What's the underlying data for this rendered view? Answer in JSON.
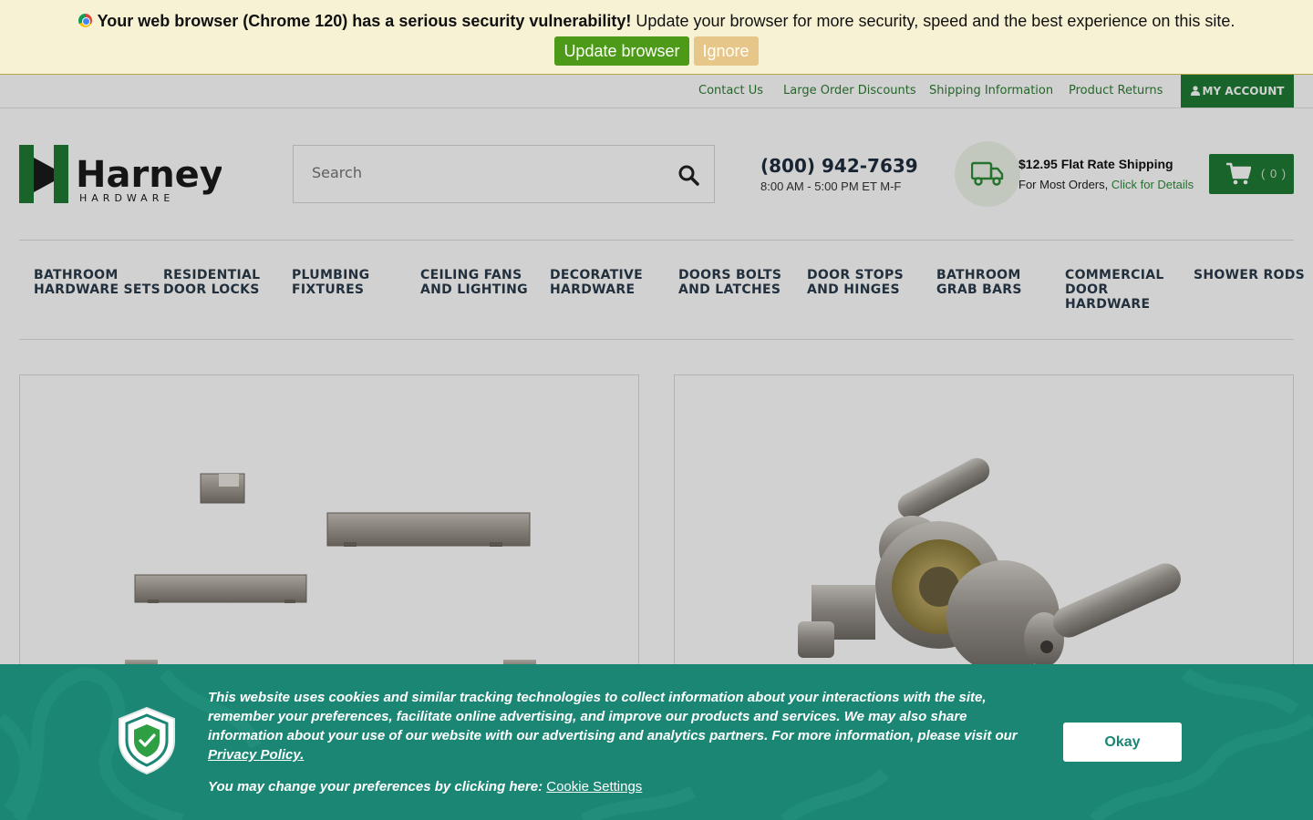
{
  "browser_warning": {
    "bold_text": "Your web browser (Chrome 120) has a serious security vulnerability!",
    "text": " Update your browser for more security, speed and the best experience on this site.",
    "update_label": "Update browser",
    "ignore_label": "Ignore"
  },
  "utility_nav": {
    "links": [
      "Contact Us",
      "Large Order Discounts",
      "Shipping Information",
      "Product Returns"
    ],
    "account_label": "MY ACCOUNT"
  },
  "header": {
    "logo_main": "Harney",
    "logo_sub": "HARDWARE",
    "search_placeholder": "Search",
    "phone": "(800) 942-7639",
    "hours": "8:00 AM - 5:00 PM ET M-F",
    "shipping_title": "$12.95 Flat Rate Shipping",
    "shipping_sub": "For Most Orders, ",
    "shipping_link": "Click for Details",
    "cart_count": "( 0 )"
  },
  "categories": [
    "BATHROOM\nHARDWARE SETS",
    "RESIDENTIAL\nDOOR LOCKS",
    "PLUMBING\nFIXTURES",
    "CEILING FANS\nAND LIGHTING",
    "DECORATIVE\nHARDWARE",
    "DOORS BOLTS\nAND LATCHES",
    "DOOR STOPS\nAND HINGES",
    "BATHROOM\nGRAB BARS",
    "COMMERCIAL\nDOOR\nHARDWARE",
    "SHOWER RODS"
  ],
  "cookie_banner": {
    "text": "This website uses cookies and similar tracking technologies to collect information about your interactions with the site, remember your preferences, facilitate online advertising, and improve our products and services. We may also share information about your use of our website with our advertising and analytics partners. For more information, please visit our ",
    "privacy_link": "Privacy Policy.",
    "pref_text": "You may change your preferences by clicking here: ",
    "settings_link": "Cookie Settings",
    "okay_label": "Okay"
  },
  "colors": {
    "brand_green": "#1f7a34",
    "cookie_teal": "#1b8674",
    "warning_bg": "#f7f2d4"
  },
  "icons": [
    "chrome-icon",
    "user-icon",
    "search-icon",
    "truck-icon",
    "cart-icon",
    "shield-icon"
  ]
}
